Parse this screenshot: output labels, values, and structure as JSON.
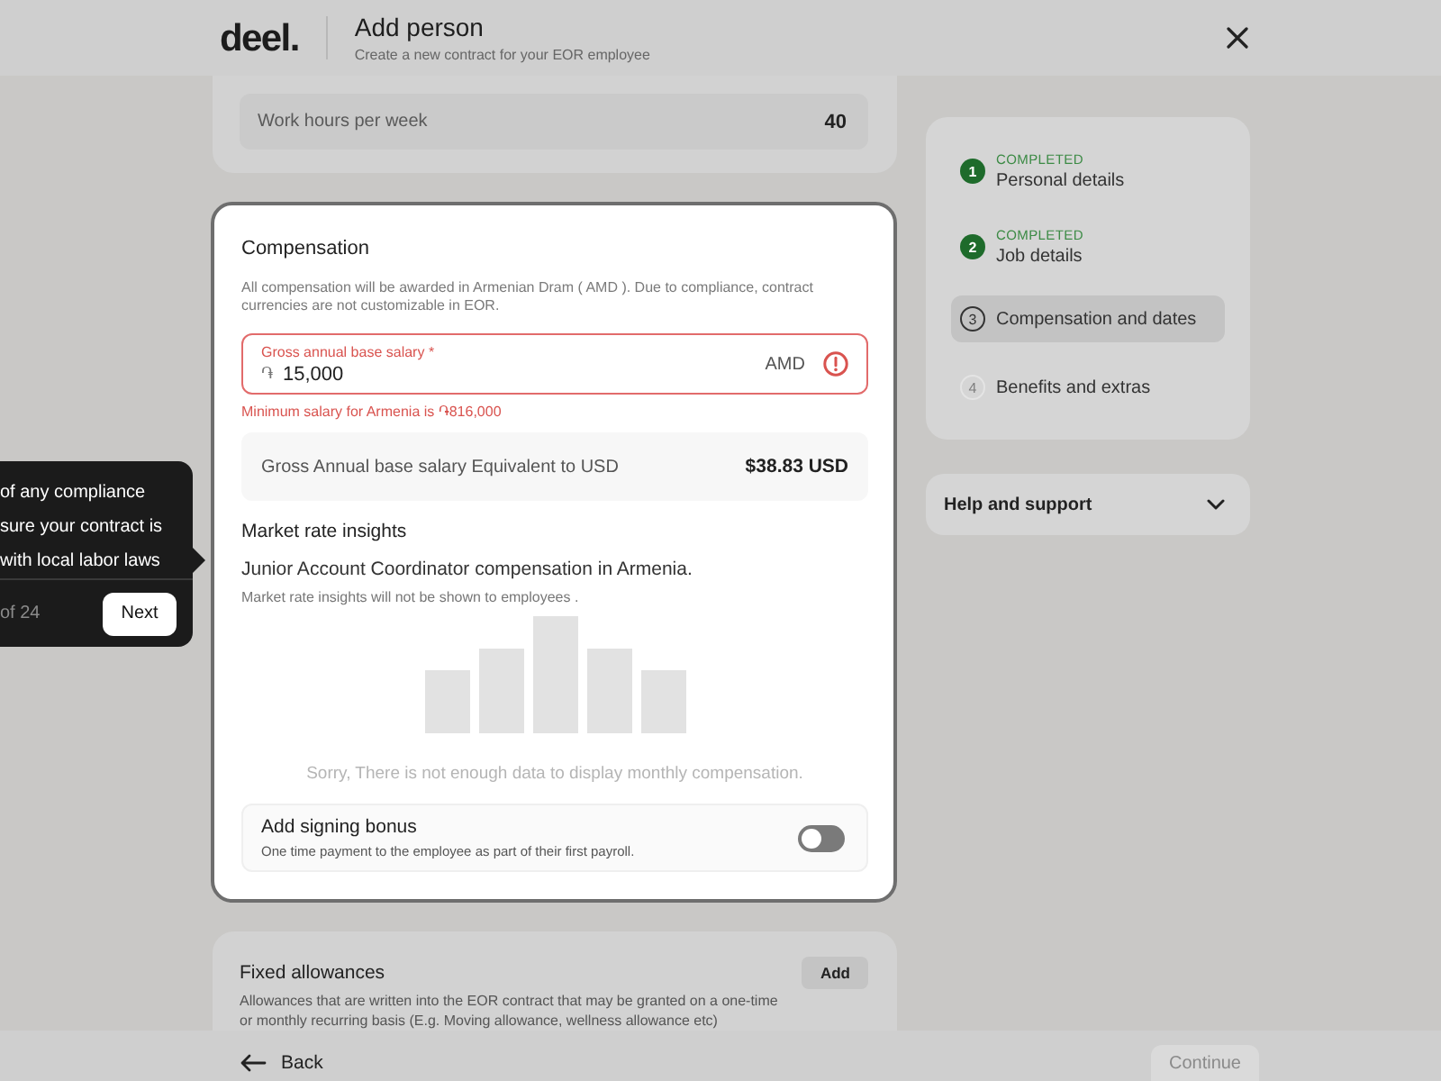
{
  "header": {
    "logo": "deel.",
    "title": "Add person",
    "subtitle": "Create a new contract for your EOR employee"
  },
  "work_hours": {
    "label": "Work hours per week",
    "value": "40"
  },
  "compensation": {
    "highlighted": true,
    "title": "Compensation",
    "description": "All compensation will be awarded in Armenian Dram ( AMD ). Due to compliance, contract currencies are not customizable in EOR.",
    "salary_field": {
      "label": "Gross annual base salary *",
      "prefix": "֏",
      "value": "15,000",
      "suffix": "AMD",
      "error": true,
      "error_message": "Minimum salary for Armenia is ֏816,000"
    },
    "usd_equivalent": {
      "label": "Gross Annual base salary Equivalent to USD",
      "value": "$38.83 USD"
    },
    "market_insights": {
      "title": "Market rate insights",
      "subtitle": "Junior Account Coordinator compensation in Armenia.",
      "note": "Market rate insights will not be shown to employees .",
      "empty_message": "Sorry, There is not enough data to display monthly compensation."
    },
    "signing_bonus": {
      "title": "Add signing bonus",
      "description": "One time payment to the employee as part of their first payroll.",
      "on": false
    }
  },
  "fixed_allowances": {
    "title": "Fixed allowances",
    "button": "Add",
    "description": "Allowances that are written into the EOR contract that may be granted on a one-time or monthly recurring basis (E.g. Moving allowance, wellness allowance etc)"
  },
  "steps": [
    {
      "number": "1",
      "status": "COMPLETED",
      "label": "Personal details",
      "completed": true,
      "selected": false
    },
    {
      "number": "2",
      "status": "COMPLETED",
      "label": "Job details",
      "completed": true,
      "selected": false
    },
    {
      "number": "3",
      "label": "Compensation and dates",
      "completed": false,
      "selected": true
    },
    {
      "number": "4",
      "label": "Benefits and extras",
      "completed": false,
      "selected": false
    }
  ],
  "help": {
    "title": "Help and support",
    "expanded": false
  },
  "footer": {
    "back": "Back",
    "continue": {
      "label": "Continue",
      "disabled": true
    }
  },
  "tour_tooltip": {
    "text": "of any compliance\nsure your contract is\nwith local labor laws",
    "counter": "of 24",
    "button": "Next"
  }
}
